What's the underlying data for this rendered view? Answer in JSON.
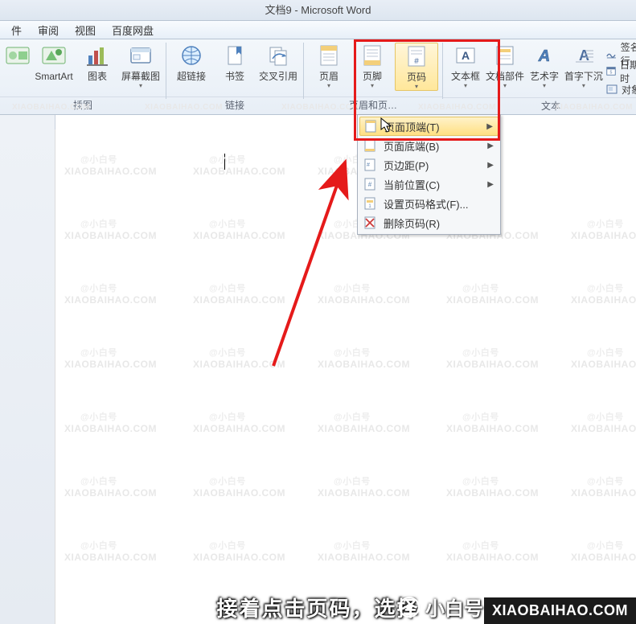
{
  "title": "文档9 - Microsoft Word",
  "menubar": {
    "items": [
      "件",
      "审阅",
      "视图",
      "百度网盘"
    ]
  },
  "ribbon": {
    "groups": [
      {
        "label": "插图",
        "buttons": [
          {
            "key": "smartart",
            "label": "SmartArt"
          },
          {
            "key": "chart",
            "label": "图表"
          },
          {
            "key": "screenshot",
            "label": "屏幕截图",
            "drop": true
          }
        ]
      },
      {
        "label": "链接",
        "buttons": [
          {
            "key": "hyperlink",
            "label": "超链接"
          },
          {
            "key": "bookmark",
            "label": "书签"
          },
          {
            "key": "crossref",
            "label": "交叉引用"
          }
        ]
      },
      {
        "label": "页眉和页…",
        "buttons": [
          {
            "key": "header",
            "label": "页眉",
            "drop": true
          },
          {
            "key": "footer",
            "label": "页脚",
            "drop": true
          },
          {
            "key": "pagenum",
            "label": "页码",
            "drop": true,
            "highlighted": true
          }
        ]
      },
      {
        "label": "文本",
        "buttons": [
          {
            "key": "textbox",
            "label": "文本框",
            "drop": true
          },
          {
            "key": "quickparts",
            "label": "文档部件",
            "drop": true
          },
          {
            "key": "wordart",
            "label": "艺术字",
            "drop": true
          },
          {
            "key": "dropcap",
            "label": "首字下沉",
            "drop": true
          }
        ],
        "small": [
          {
            "key": "sigline",
            "label": "签名行"
          },
          {
            "key": "datetime",
            "label": "日期和时"
          },
          {
            "key": "object",
            "label": "对象"
          }
        ]
      }
    ]
  },
  "menu_popup": {
    "items": [
      {
        "key": "top",
        "label": "页面顶端(T)",
        "sub": true,
        "selected": true
      },
      {
        "key": "bottom",
        "label": "页面底端(B)",
        "sub": true
      },
      {
        "key": "margins",
        "label": "页边距(P)",
        "sub": true
      },
      {
        "key": "current",
        "label": "当前位置(C)",
        "sub": true
      },
      {
        "key": "format",
        "label": "设置页码格式(F)..."
      },
      {
        "key": "remove",
        "label": "删除页码(R)"
      }
    ]
  },
  "caption": "接着点击页码，选择",
  "brand": "小白号",
  "source_badge": "XIAOBAIHAO.COM",
  "watermark": {
    "text1": "@小白号",
    "text2": "XIAOBAIHAO.COM"
  }
}
